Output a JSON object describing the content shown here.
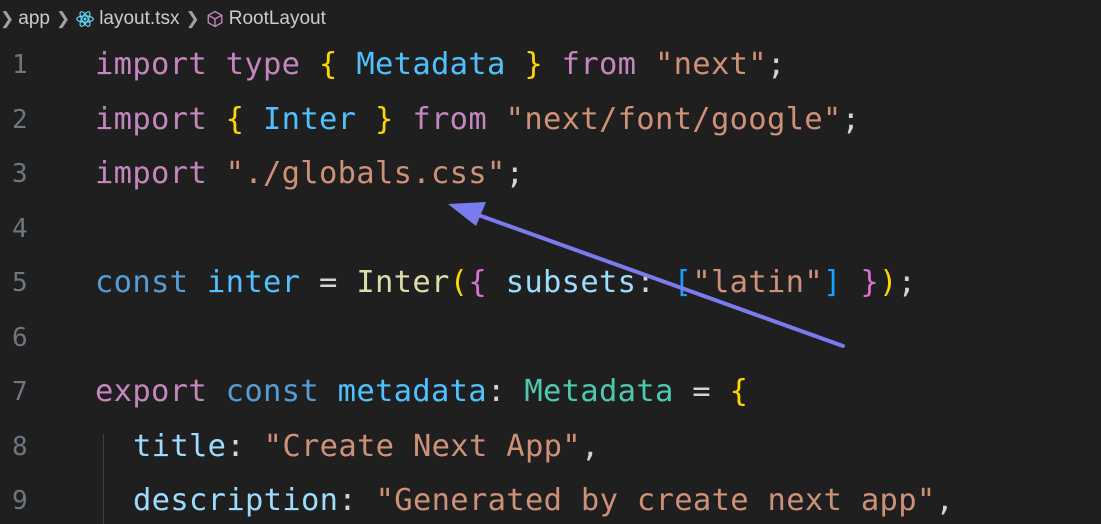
{
  "breadcrumb": {
    "items": [
      {
        "label": "app",
        "icon": "chevron-right-icon"
      },
      {
        "label": "layout.tsx",
        "icon": "react-icon"
      },
      {
        "label": "RootLayout",
        "icon": "symbol-method-icon"
      }
    ]
  },
  "editor": {
    "line_numbers": [
      "1",
      "2",
      "3",
      "4",
      "5",
      "6",
      "7",
      "8",
      "9"
    ],
    "lines": [
      {
        "tokens": [
          "import",
          "type",
          "{",
          "Metadata",
          "}",
          "from",
          "\"next\"",
          ";"
        ]
      },
      {
        "tokens": [
          "import",
          "{",
          "Inter",
          "}",
          "from",
          "\"next/font/google\"",
          ";"
        ]
      },
      {
        "tokens": [
          "import",
          "\"./globals.css\"",
          ";"
        ]
      },
      {
        "tokens": []
      },
      {
        "tokens": [
          "const",
          "inter",
          "=",
          "Inter",
          "(",
          "{",
          "subsets",
          ":",
          "[",
          "\"latin\"",
          "]",
          "}",
          ")",
          ";"
        ]
      },
      {
        "tokens": []
      },
      {
        "tokens": [
          "export",
          "const",
          "metadata",
          ":",
          "Metadata",
          "=",
          "{"
        ]
      },
      {
        "tokens": [
          "title",
          ":",
          "\"Create Next App\"",
          ","
        ]
      },
      {
        "tokens": [
          "description",
          ":",
          "\"Generated by create next app\"",
          ","
        ]
      }
    ]
  },
  "annotation": {
    "icon": "arrow-annotation",
    "color": "#7b7bf0"
  },
  "colors": {
    "background": "#1f1f1f",
    "keyword": "#c586c0",
    "storage": "#569cd6",
    "type": "#4ec9b0",
    "string": "#ce9178",
    "property": "#9cdcfe",
    "function": "#dcdcaa",
    "line_number": "#6e7681"
  }
}
